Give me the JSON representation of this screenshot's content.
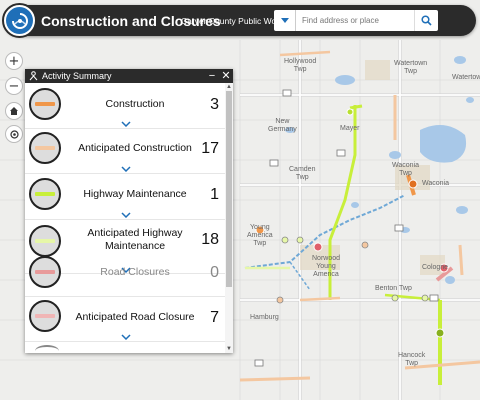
{
  "header": {
    "title": "Construction and Closures",
    "subtitle": "Carver County Public Works",
    "search_placeholder": "Find address or place"
  },
  "panel": {
    "title": "Activity Summary",
    "items": [
      {
        "label": "Construction",
        "count": "3",
        "color": "#f0974a"
      },
      {
        "label": "Anticipated Construction",
        "count": "17",
        "color": "#f4c7a0"
      },
      {
        "label": "Highway Maintenance",
        "count": "1",
        "color": "#c8ef3a"
      },
      {
        "label": "Anticipated Highway Maintenance",
        "count": "18",
        "color": "#e6f7a8"
      },
      {
        "label": "Road Closures",
        "count": "0",
        "color": "#e89a9a",
        "muted": true
      },
      {
        "label": "Anticipated Road Closure",
        "count": "7",
        "color": "#f0b5b5"
      }
    ]
  },
  "map": {
    "places": [
      {
        "text": "Hollywood\nTwp"
      },
      {
        "text": "Watertown\nTwp"
      },
      {
        "text": "Watertown"
      },
      {
        "text": "New\nGermany"
      },
      {
        "text": "Mayer"
      },
      {
        "text": "Camden\nTwp"
      },
      {
        "text": "Waconia\nTwp"
      },
      {
        "text": "Waconia"
      },
      {
        "text": "Young\nAmerica\nTwp"
      },
      {
        "text": "Norwood\nYoung\nAmerica"
      },
      {
        "text": "Cologne"
      },
      {
        "text": "Benton Twp"
      },
      {
        "text": "Hamburg"
      },
      {
        "text": "Hancock\nTwp"
      }
    ]
  }
}
